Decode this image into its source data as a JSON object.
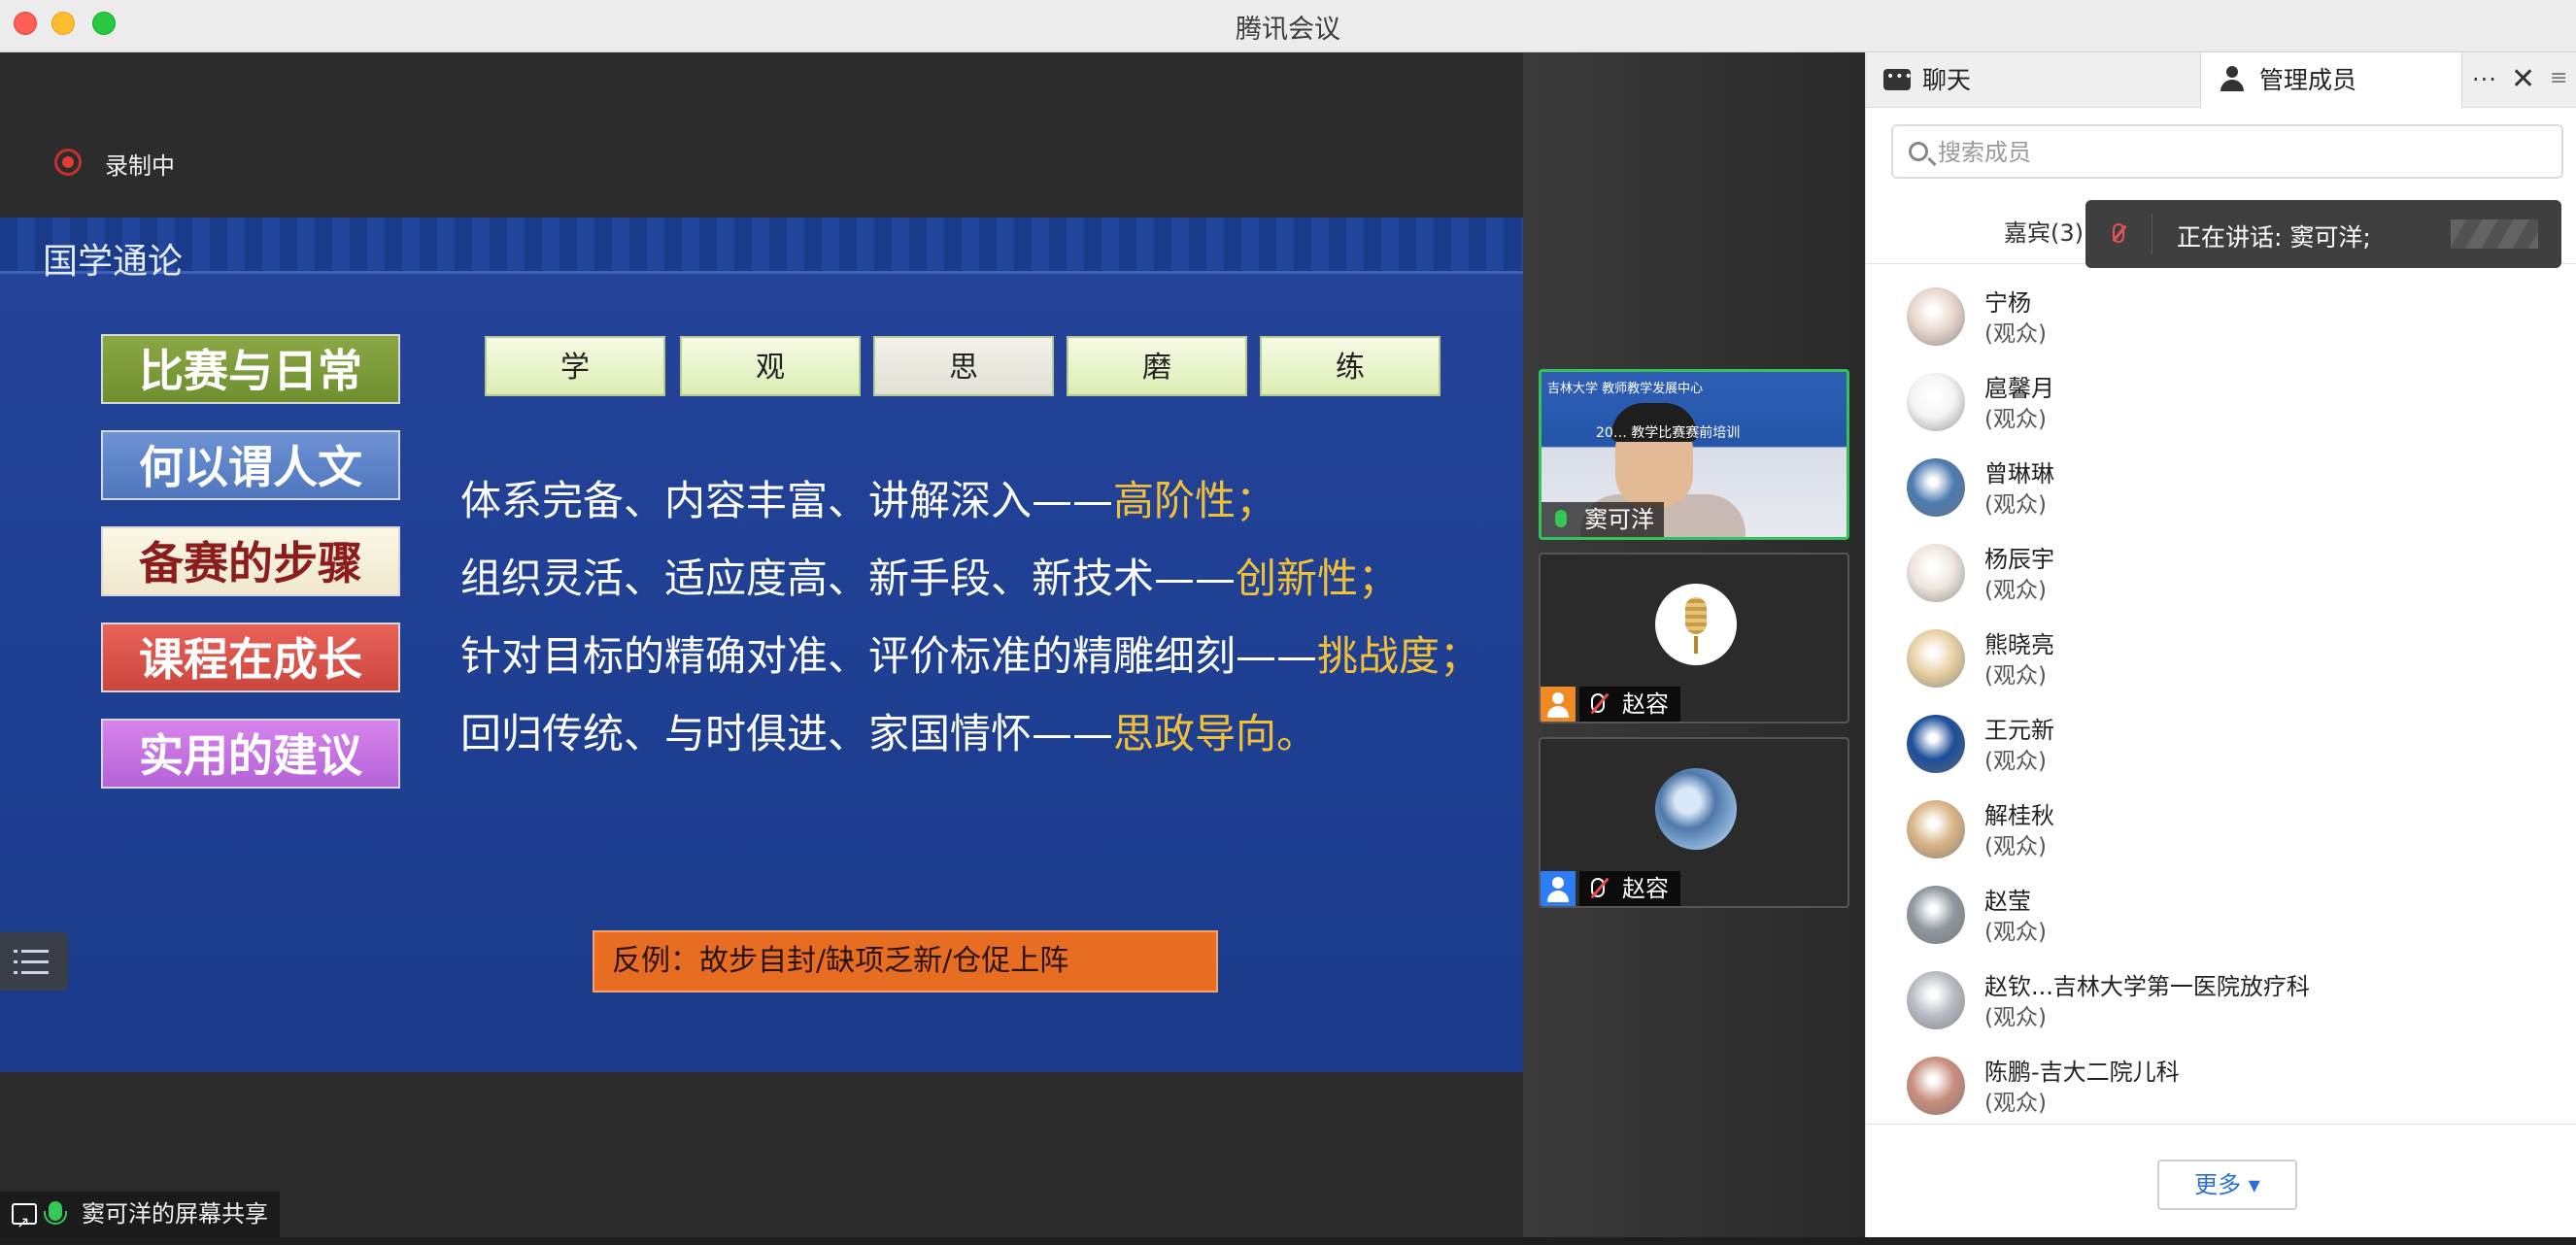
{
  "window": {
    "title": "腾讯会议"
  },
  "recording": {
    "label": "录制中"
  },
  "slide": {
    "title": "国学通论",
    "menu": [
      "比赛与日常",
      "何以谓人文",
      "备赛的步骤",
      "课程在成长",
      "实用的建议"
    ],
    "tabs": [
      "学",
      "观",
      "思",
      "磨",
      "练"
    ],
    "selected_tab": "思",
    "lines": [
      {
        "text": "体系完备、内容丰富、讲解深入——",
        "highlight": "高阶性；"
      },
      {
        "text": "组织灵活、适应度高、新手段、新技术——",
        "highlight": "创新性；"
      },
      {
        "text": "针对目标的精确对准、评价标准的精雕细刻——",
        "highlight": "挑战度；"
      },
      {
        "text": "回归传统、与时俱进、家国情怀——",
        "highlight": "思政导向。"
      }
    ],
    "counterexample": "反例：故步自封/缺项乏新/仓促上阵"
  },
  "share": {
    "label": "窦可洋的屏幕共享"
  },
  "video_tiles": [
    {
      "name": "窦可洋",
      "banner": "吉林大学 教师教学发展中心",
      "subtitle": "20… 教学比赛赛前培训",
      "speaking": true
    },
    {
      "name": "赵容",
      "muted": true
    },
    {
      "name": "赵容",
      "muted": true
    }
  ],
  "panel": {
    "tabs": {
      "chat": "聊天",
      "members": "管理成员"
    },
    "more_icon": "···",
    "close_icon": "✕",
    "side_icon": "≡",
    "search_placeholder": "搜索成员",
    "guests_label": "嘉宾(3)",
    "speaking_toast": "正在讲话: 窦可洋;",
    "members": [
      {
        "name": "宁杨",
        "role": "(观众)",
        "avatar_color": "#e8d6cc"
      },
      {
        "name": "扈馨月",
        "role": "(观众)",
        "avatar_color": "#f4f4f4"
      },
      {
        "name": "曾琳琳",
        "role": "(观众)",
        "avatar_color": "#4d7bb1"
      },
      {
        "name": "杨辰宇",
        "role": "(观众)",
        "avatar_color": "#efe6dc"
      },
      {
        "name": "熊晓亮",
        "role": "(观众)",
        "avatar_color": "#e8d1a4"
      },
      {
        "name": "王元新",
        "role": "(观众)",
        "avatar_color": "#1d4f9a"
      },
      {
        "name": "解桂秋",
        "role": "(观众)",
        "avatar_color": "#d9b487"
      },
      {
        "name": "赵莹",
        "role": "(观众)",
        "avatar_color": "#8f979f"
      },
      {
        "name": "赵钦...吉林大学第一医院放疗科",
        "role": "(观众)",
        "avatar_color": "#b8bcc4"
      },
      {
        "name": "陈鹏-吉大二院儿科",
        "role": "(观众)",
        "avatar_color": "#c98f7d"
      }
    ],
    "more_button": "更多 ▾"
  }
}
